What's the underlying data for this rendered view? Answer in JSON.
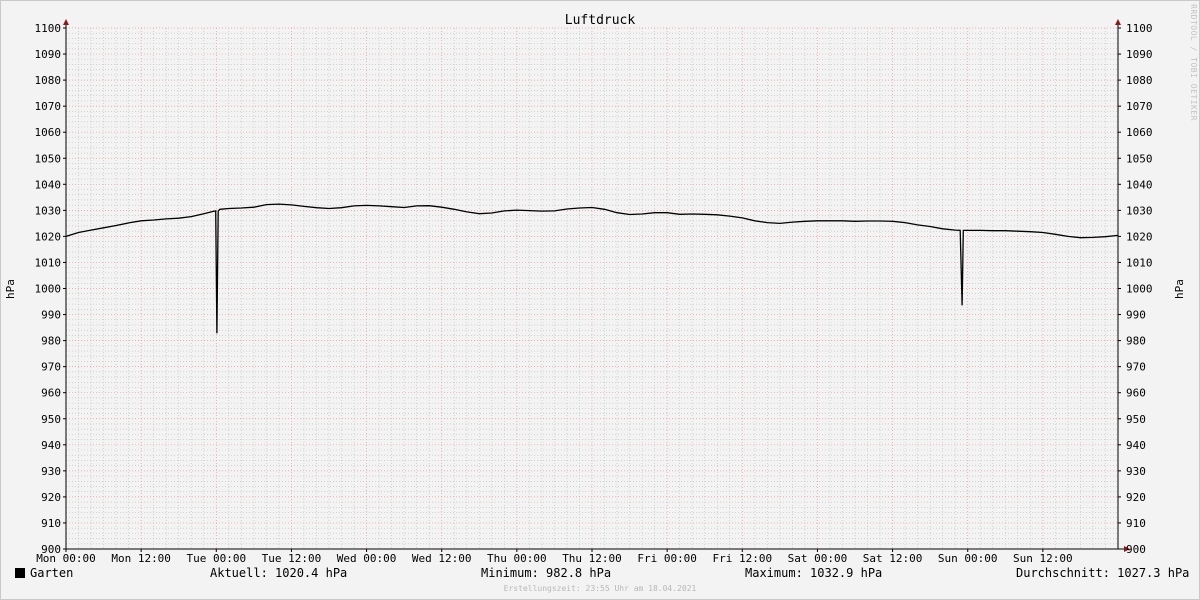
{
  "chart_data": {
    "type": "line",
    "title": "Luftdruck",
    "ylabel": "hPa",
    "ylim": [
      900,
      1100
    ],
    "yticks": [
      900,
      910,
      920,
      930,
      940,
      950,
      960,
      970,
      980,
      990,
      1000,
      1010,
      1020,
      1030,
      1040,
      1050,
      1060,
      1070,
      1080,
      1090,
      1100
    ],
    "xlim": [
      0,
      168
    ],
    "x_unit": "hours since Mon 00:00",
    "xticks": [
      {
        "label": "Mon 00:00",
        "x": 0
      },
      {
        "label": "Mon 12:00",
        "x": 12
      },
      {
        "label": "Tue 00:00",
        "x": 24
      },
      {
        "label": "Tue 12:00",
        "x": 36
      },
      {
        "label": "Wed 00:00",
        "x": 48
      },
      {
        "label": "Wed 12:00",
        "x": 60
      },
      {
        "label": "Thu 00:00",
        "x": 72
      },
      {
        "label": "Thu 12:00",
        "x": 84
      },
      {
        "label": "Fri 00:00",
        "x": 96
      },
      {
        "label": "Fri 12:00",
        "x": 108
      },
      {
        "label": "Sat 00:00",
        "x": 120
      },
      {
        "label": "Sat 12:00",
        "x": 132
      },
      {
        "label": "Sun 00:00",
        "x": 144
      },
      {
        "label": "Sun 12:00",
        "x": 156
      }
    ],
    "grid": true,
    "legend": "bottom-left",
    "series": [
      {
        "name": "Garten",
        "color": "#000000",
        "x": [
          0,
          2,
          4,
          6,
          8,
          10,
          12,
          14,
          16,
          18,
          20,
          22,
          23.5,
          23.9,
          24.1,
          24.3,
          24.6,
          26,
          28,
          30,
          32,
          34,
          36,
          38,
          40,
          42,
          44,
          46,
          48,
          50,
          52,
          54,
          56,
          58,
          60,
          62,
          64,
          66,
          68,
          70,
          72,
          74,
          76,
          78,
          80,
          82,
          84,
          86,
          88,
          90,
          92,
          94,
          96,
          98,
          100,
          102,
          104,
          106,
          108,
          110,
          112,
          114,
          116,
          118,
          120,
          122,
          124,
          126,
          128,
          130,
          132,
          134,
          136,
          138,
          140,
          142,
          142.8,
          143.1,
          143.3,
          143.6,
          146,
          148,
          150,
          152,
          154,
          156,
          158,
          160,
          162,
          164,
          166,
          168
        ],
        "values": [
          1020,
          1021.5,
          1022.4,
          1023.3,
          1024.2,
          1025.2,
          1026,
          1026.3,
          1026.7,
          1027,
          1027.6,
          1028.7,
          1029.6,
          1029.8,
          982.8,
          1029.8,
          1030.4,
          1030.7,
          1030.9,
          1031.2,
          1032.2,
          1032.4,
          1032.1,
          1031.5,
          1031,
          1030.7,
          1031,
          1031.7,
          1031.9,
          1031.7,
          1031.4,
          1031.1,
          1031.7,
          1031.8,
          1031.2,
          1030.4,
          1029.4,
          1028.7,
          1029,
          1029.8,
          1030.1,
          1029.9,
          1029.7,
          1029.8,
          1030.5,
          1030.9,
          1031.1,
          1030.4,
          1029.1,
          1028.4,
          1028.6,
          1029.1,
          1029.1,
          1028.5,
          1028.6,
          1028.5,
          1028.3,
          1027.8,
          1027.1,
          1026,
          1025.3,
          1025,
          1025.5,
          1025.8,
          1026,
          1026,
          1026,
          1025.8,
          1025.9,
          1025.9,
          1025.8,
          1025.3,
          1024.4,
          1023.8,
          1022.9,
          1022.4,
          1022.3,
          993.5,
          1022.3,
          1022.3,
          1022.3,
          1022.2,
          1022.2,
          1022,
          1021.8,
          1021.5,
          1020.8,
          1020,
          1019.5,
          1019.6,
          1019.9,
          1020.4
        ]
      }
    ]
  },
  "legend": {
    "series_name": "Garten",
    "current": "Aktuell: 1020.4 hPa",
    "minimum": "Minimum: 982.8 hPa",
    "maximum": "Maximum: 1032.9 hPa",
    "average": "Durchschnitt: 1027.3 hPa"
  },
  "footer": "Erstellungszeit: 23:55 Uhr am 18.04.2021",
  "watermark": "RRDTOOL / TOBI OETIKER",
  "colors": {
    "minor_grid": "#bdbdbd",
    "major_grid": "#e39a9a",
    "axis": "#000000",
    "arrow": "#8b1a1a",
    "line": "#000000"
  }
}
